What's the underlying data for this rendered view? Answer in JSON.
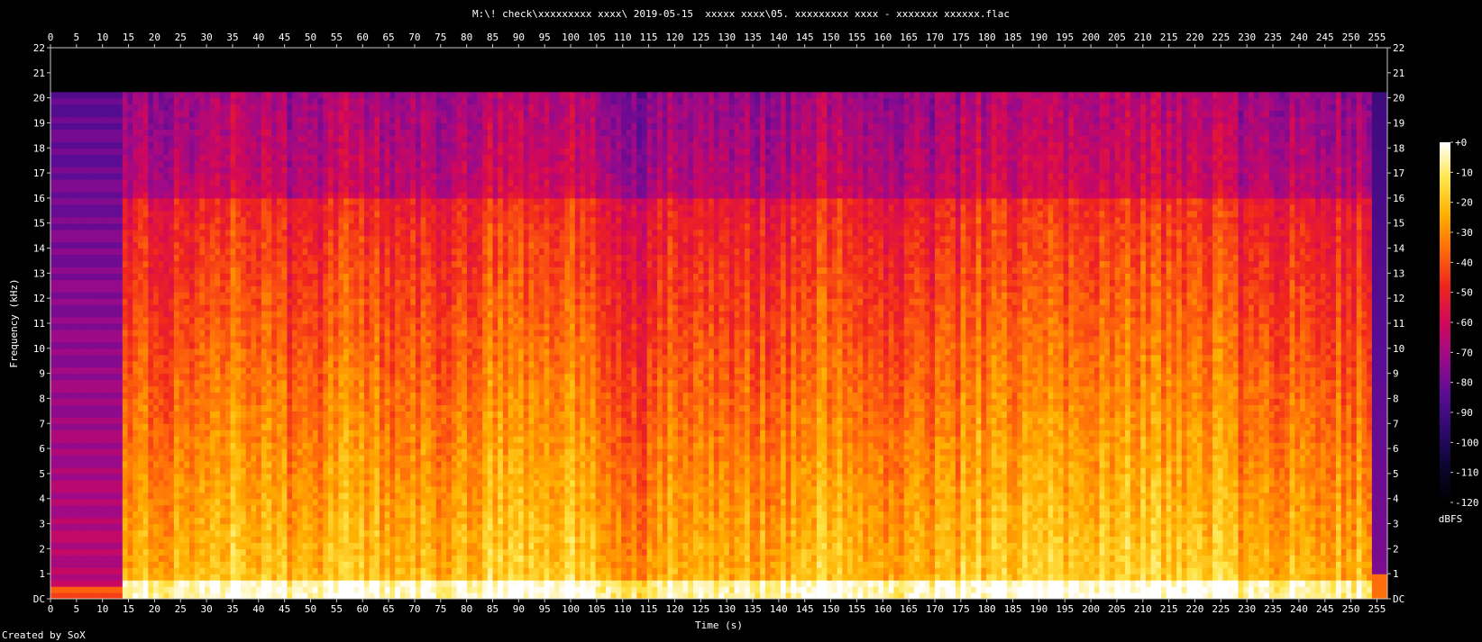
{
  "title": "M:\\! check\\xxxxxxxxx xxxx\\ 2019-05-15  xxxxx xxxx\\05. xxxxxxxxx xxxx - xxxxxxx xxxxxx.flac",
  "footer": "Created by SoX",
  "colors": {
    "background": "#000000",
    "axis": "#c8c8c8",
    "palette": [
      "#000000",
      "#0b0630",
      "#2d0a6e",
      "#5a0c94",
      "#9a0a8a",
      "#d2085a",
      "#f0241e",
      "#ff6a0a",
      "#ffb000",
      "#ffe64a",
      "#ffffff"
    ]
  },
  "chart_data": {
    "type": "heatmap",
    "title": "M:\\! check\\xxxxxxxxx xxxx\\ 2019-05-15  xxxxx xxxx\\05. xxxxxxxxx xxxx - xxxxxxx xxxxxx.flac",
    "xlabel": "Time (s)",
    "ylabel": "Frequency (kHz)",
    "xlim": [
      0,
      257
    ],
    "ylim": [
      0,
      22
    ],
    "x_ticks": [
      0,
      5,
      10,
      15,
      20,
      25,
      30,
      35,
      40,
      45,
      50,
      55,
      60,
      65,
      70,
      75,
      80,
      85,
      90,
      95,
      100,
      105,
      110,
      115,
      120,
      125,
      130,
      135,
      140,
      145,
      150,
      155,
      160,
      165,
      170,
      175,
      180,
      185,
      190,
      195,
      200,
      205,
      210,
      215,
      220,
      225,
      230,
      235,
      240,
      245,
      250,
      255
    ],
    "y_ticks": [
      "DC",
      "1",
      "2",
      "3",
      "4",
      "5",
      "6",
      "7",
      "8",
      "9",
      "10",
      "11",
      "12",
      "13",
      "14",
      "15",
      "16",
      "17",
      "18",
      "19",
      "20",
      "21",
      "22"
    ],
    "colorbar": {
      "label": "dBFS",
      "range": [
        -120,
        0
      ],
      "ticks": [
        "+0",
        "-10",
        "-20",
        "-30",
        "-40",
        "-50",
        "-60",
        "-70",
        "-80",
        "-90",
        "-100",
        "-110",
        "-120"
      ]
    },
    "signal_start_s": 14,
    "signal_end_s": 254,
    "cutoff_khz": 20,
    "upper_band_cutoff_khz": 16
  }
}
